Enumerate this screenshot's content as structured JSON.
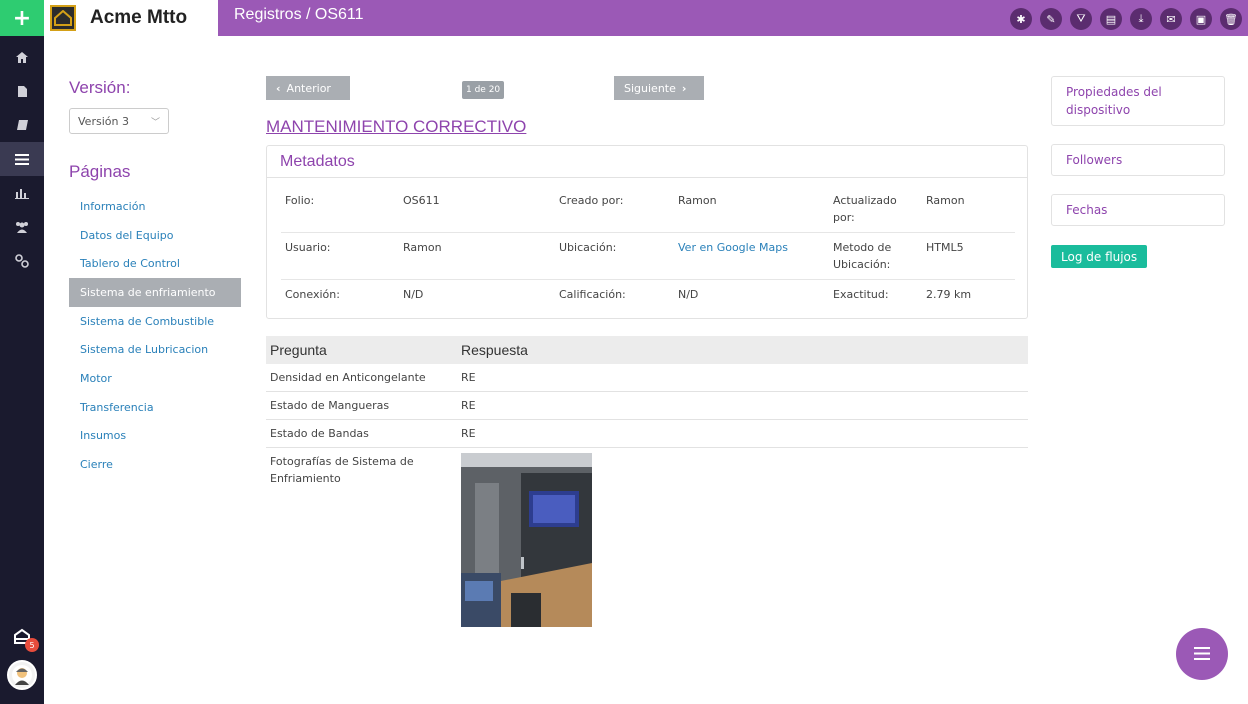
{
  "brand": {
    "name": "Acme Mtto"
  },
  "header": {
    "breadcrumb": "Registros / OS611",
    "actions": [
      "gear-icon",
      "pencil-icon",
      "road-icon",
      "file-icon",
      "download-icon",
      "envelope-icon",
      "archive-icon",
      "trash-icon"
    ]
  },
  "rail": {
    "items": [
      "home-icon",
      "file-icon",
      "book-icon",
      "list-icon",
      "bar-chart-icon",
      "users-icon",
      "link-icon"
    ],
    "active_index": 3,
    "notification_count": "5"
  },
  "sidebar": {
    "version_label": "Versión:",
    "version_selected": "Versión 3",
    "pages_label": "Páginas",
    "pages": [
      "Información",
      "Datos del Equipo",
      "Tablero de Control",
      "Sistema de enfriamiento",
      "Sistema de Combustible",
      "Sistema de Lubricacion",
      "Motor",
      "Transferencia",
      "Insumos",
      "Cierre"
    ],
    "active_page": "Sistema de enfriamiento"
  },
  "nav": {
    "prev_label": "Anterior",
    "next_label": "Siguiente",
    "page_count": "1 de 20"
  },
  "form": {
    "title": "MANTENIMIENTO CORRECTIVO"
  },
  "metadata": {
    "heading": "Metadatos",
    "rows": [
      [
        {
          "label": "Folio:",
          "value": "OS611"
        },
        {
          "label": "Creado por:",
          "value": "Ramon"
        },
        {
          "label": "Actualizado por:",
          "value": "Ramon"
        }
      ],
      [
        {
          "label": "Usuario:",
          "value": "Ramon"
        },
        {
          "label": "Ubicación:",
          "value": "Ver en Google Maps",
          "link": true
        },
        {
          "label": "Metodo de Ubicación:",
          "value": "HTML5"
        }
      ],
      [
        {
          "label": "Conexión:",
          "value": "N/D"
        },
        {
          "label": "Calificación:",
          "value": "N/D"
        },
        {
          "label": "Exactitud:",
          "value": "2.79 km"
        }
      ]
    ]
  },
  "qa": {
    "headers": {
      "question": "Pregunta",
      "answer": "Respuesta"
    },
    "rows": [
      {
        "question": "Densidad en Anticongelante",
        "answer": "RE"
      },
      {
        "question": "Estado de Mangueras",
        "answer": "RE"
      },
      {
        "question": "Estado de Bandas",
        "answer": "RE"
      }
    ],
    "photo_question": "Fotografías de Sistema de Enfriamiento"
  },
  "right_panel": {
    "device_props": "Propiedades del dispositivo",
    "followers": "Followers",
    "dates": "Fechas",
    "log_button": "Log de flujos"
  },
  "colors": {
    "brand_purple": "#9b59b6",
    "add_green": "#2ecc71",
    "log_teal": "#1abc9c",
    "link_blue": "#2980b9",
    "rail_dark": "#1a1a2e"
  }
}
